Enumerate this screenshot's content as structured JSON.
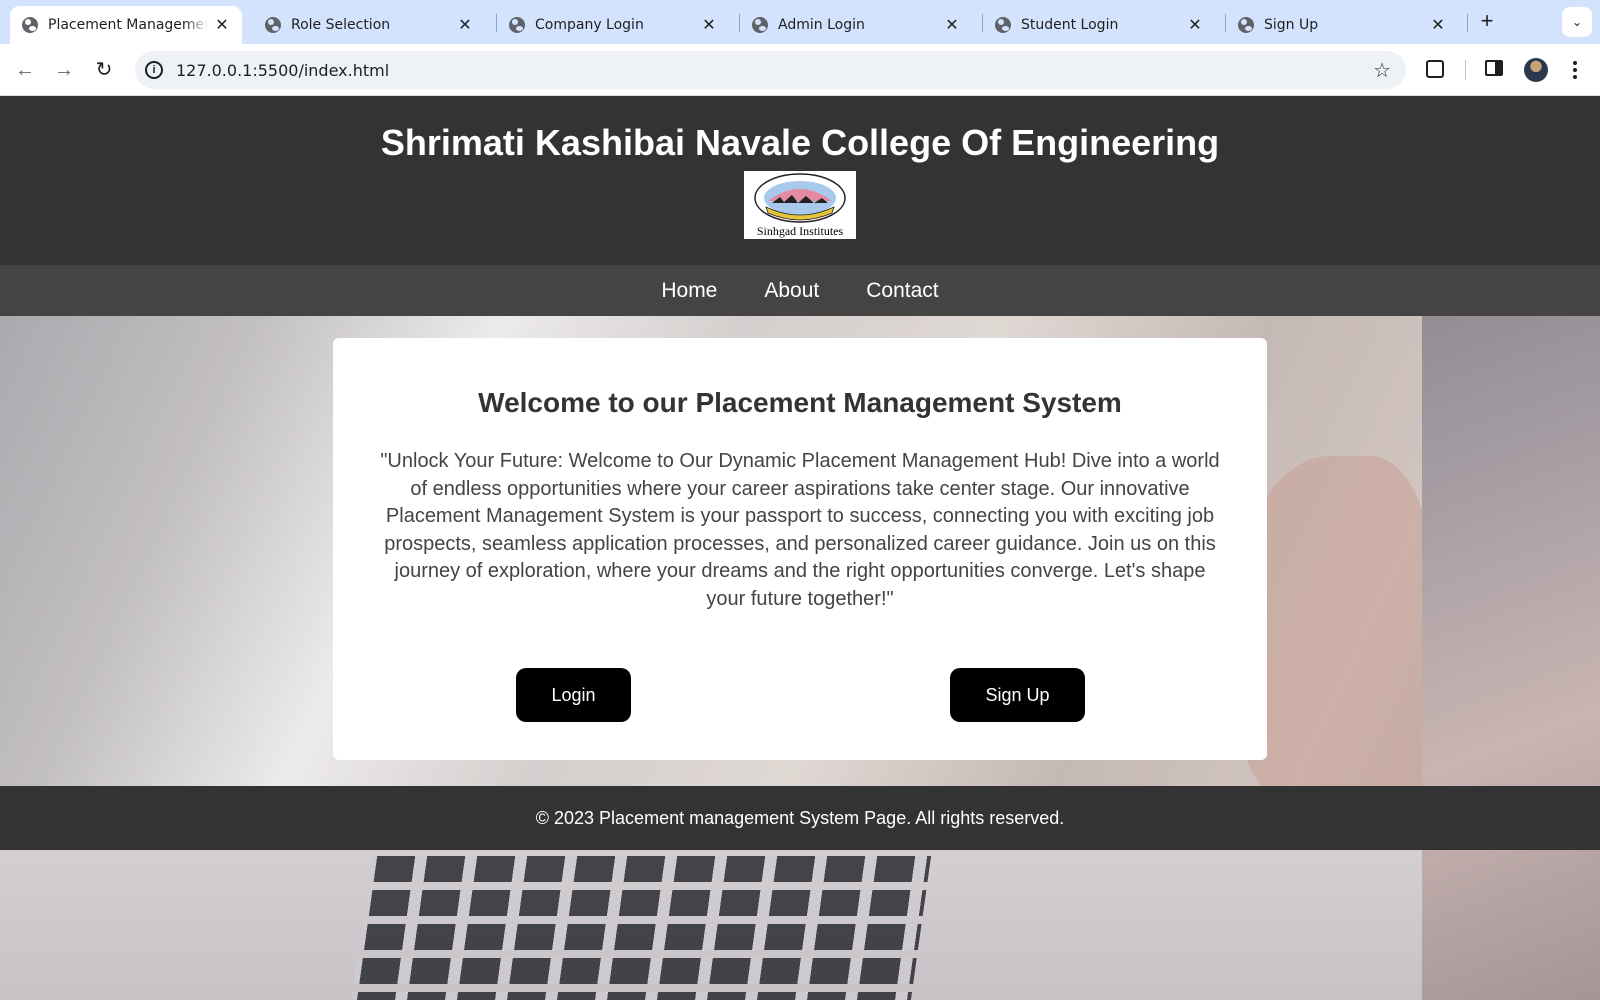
{
  "browser": {
    "tabs": [
      {
        "title": "Placement Management S",
        "active": true
      },
      {
        "title": "Role Selection",
        "active": false
      },
      {
        "title": "Company Login",
        "active": false
      },
      {
        "title": "Admin Login",
        "active": false
      },
      {
        "title": "Student Login",
        "active": false
      },
      {
        "title": "Sign Up",
        "active": false
      }
    ],
    "url": "127.0.0.1:5500/index.html"
  },
  "site": {
    "title": "Shrimati Kashibai Navale College Of Engineering",
    "logo_caption": "Sinhgad Institutes",
    "nav": [
      "Home",
      "About",
      "Contact"
    ]
  },
  "card": {
    "heading": "Welcome to our Placement Management System",
    "body": "\"Unlock Your Future: Welcome to Our Dynamic Placement Management Hub! Dive into a world of endless opportunities where your career aspirations take center stage. Our innovative Placement Management System is your passport to success, connecting you with exciting job prospects, seamless application processes, and personalized career guidance. Join us on this journey of exploration, where your dreams and the right opportunities converge. Let's shape your future together!\"",
    "login_label": "Login",
    "signup_label": "Sign Up"
  },
  "footer": {
    "text": "© 2023 Placement management System Page. All rights reserved."
  },
  "colors": {
    "header_bg": "#333333",
    "nav_bg": "#444444",
    "button_bg": "#000000",
    "tabbar_bg": "#d3e3fd"
  }
}
